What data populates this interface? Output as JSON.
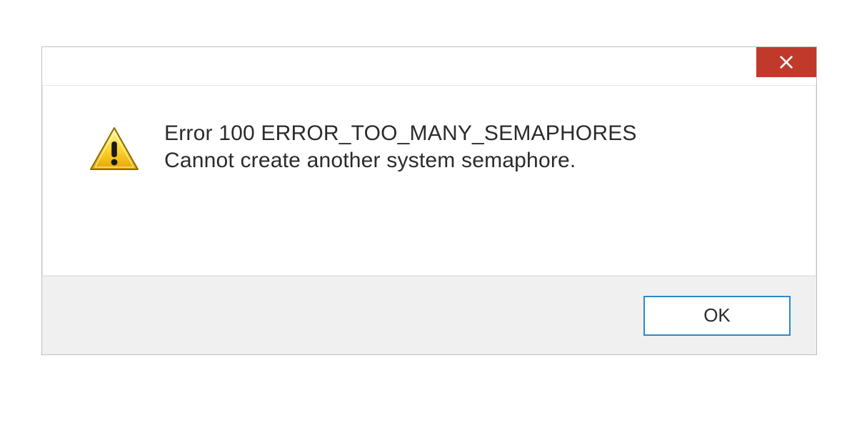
{
  "dialog": {
    "error_title": "Error 100 ERROR_TOO_MANY_SEMAPHORES",
    "error_message": "Cannot create another system semaphore.",
    "ok_label": "OK"
  },
  "colors": {
    "close_bg": "#c0392b",
    "ok_border": "#2e88c7",
    "footer_bg": "#f0f0f0"
  },
  "icons": {
    "close": "close-icon",
    "warning": "warning-triangle-icon"
  }
}
